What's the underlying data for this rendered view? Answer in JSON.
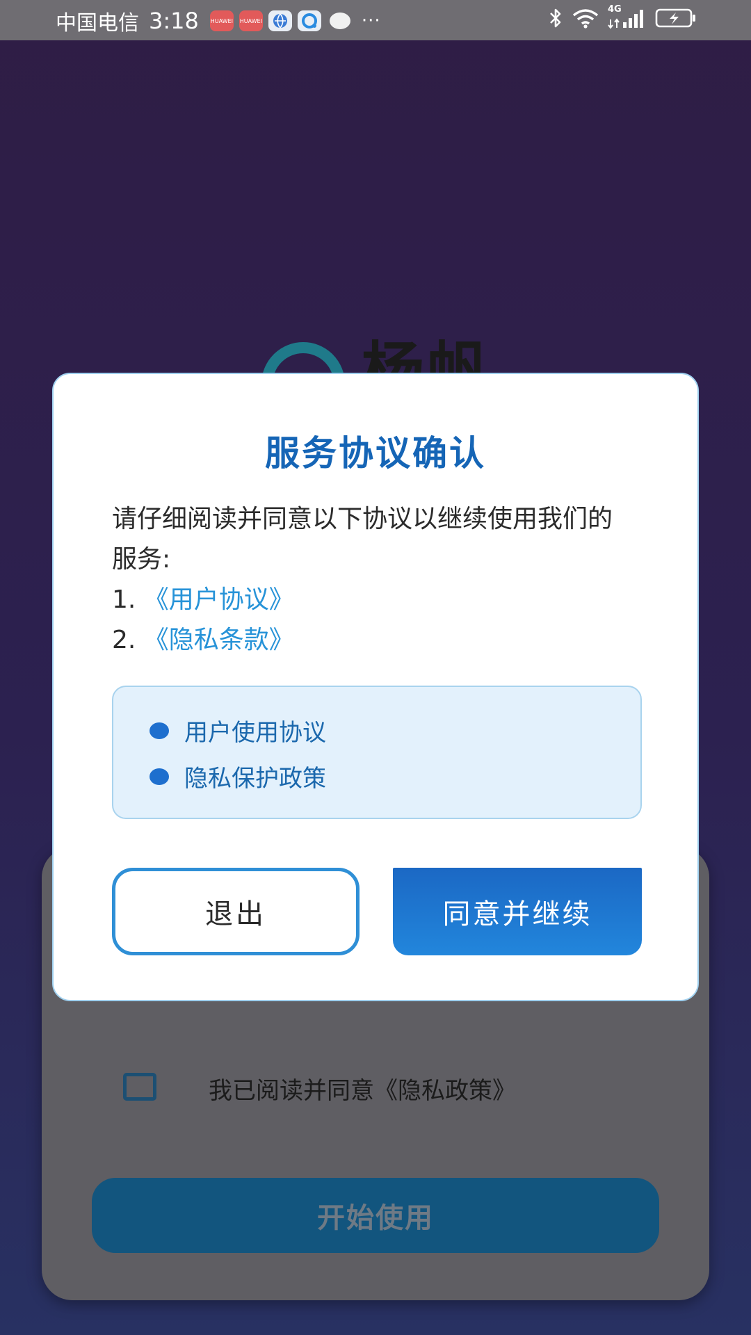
{
  "status_bar": {
    "carrier": "中国电信",
    "time": "3:18",
    "more": "···",
    "app_icons": [
      "huawei-icon",
      "huawei-icon",
      "globe-icon",
      "qq-browser-icon",
      "message-icon"
    ],
    "right_icons": [
      "bluetooth-icon",
      "wifi-icon",
      "4g-signal-icon",
      "battery-charging-icon"
    ],
    "network": "4G"
  },
  "background": {
    "logo_text": "杨帆",
    "agree_text": "我已阅读并同意《隐私政策》",
    "start_button": "开始使用"
  },
  "dialog": {
    "title": "服务协议确认",
    "intro": "请仔细阅读并同意以下协议以继续使用我们的服务:",
    "policies": [
      {
        "number": "1. ",
        "link": "《用户协议》"
      },
      {
        "number": "2. ",
        "link": "《隐私条款》"
      }
    ],
    "info_items": [
      "用户使用协议",
      "隐私保护政策"
    ],
    "exit_label": "退出",
    "agree_label": "同意并继续"
  },
  "colors": {
    "accent": "#1565b6",
    "link": "#2793d8",
    "button_primary": "#1f78d1",
    "info_box_bg": "#e3f1fc"
  }
}
